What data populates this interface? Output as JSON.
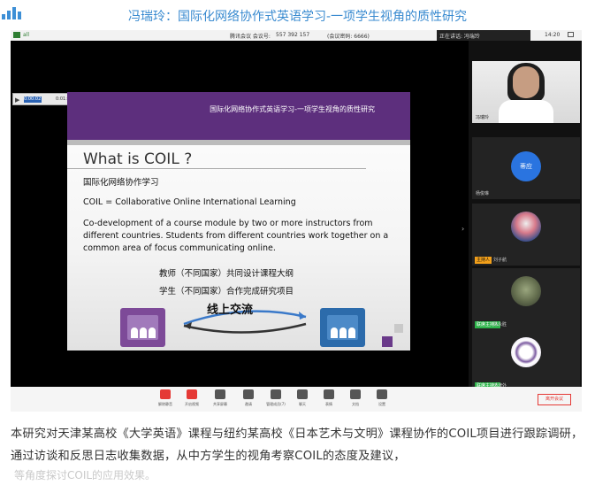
{
  "page": {
    "title": "冯瑞玲：国际化网络协作式英语学习-一项学生视角的质性研究"
  },
  "statusbar": {
    "signal": "all",
    "meeting_label": "腾讯会议 会议号:",
    "meeting_id": "557 392 157",
    "password_label": "(会议密码: 6666)",
    "speaking": "正在讲话: 冯瑞玲",
    "time": "14:20"
  },
  "player": {
    "position": "0:00:02",
    "duration": "0:01:09"
  },
  "slide": {
    "header_title": "国际化网络协作式英语学习-一项学生视角的质性研究",
    "heading": "What is COIL ?",
    "line1": "国际化网络协作学习",
    "line2": "COIL = Collaborative Online International Learning",
    "line3": "Co-development of a course module by two or more instructors from different countries. Students from different countries work together on a common area of focus communicating online.",
    "line4": "教师（不同国家）共同设计课程大纲",
    "line5": "学生（不同国家）合作完成研究项目",
    "arrow_label": "线上交流"
  },
  "gallery": {
    "self_name": "冯瑞玲",
    "tiles": [
      {
        "name": "杨俊琳",
        "avatar_text": "蒂应",
        "badge": ""
      },
      {
        "name": "刘子航",
        "badge": "主持人"
      },
      {
        "name": "陈永胜",
        "badge": "联席主持人"
      },
      {
        "name": "天津外",
        "badge": "联席主持人"
      }
    ]
  },
  "toolbar": {
    "items": [
      {
        "label": "解除静音",
        "icon": "mic-muted-icon"
      },
      {
        "label": "开启视频",
        "icon": "video-off-icon"
      },
      {
        "label": "共享屏幕",
        "icon": "screen-share-icon"
      },
      {
        "label": "邀请",
        "icon": "invite-icon"
      },
      {
        "label": "管理成员(7)",
        "icon": "members-icon"
      },
      {
        "label": "聊天",
        "icon": "chat-icon"
      },
      {
        "label": "表情",
        "icon": "emoji-icon"
      },
      {
        "label": "文档",
        "icon": "document-icon"
      },
      {
        "label": "设置",
        "icon": "settings-icon"
      }
    ],
    "end_label": "离开会议"
  },
  "caption": {
    "text": "本研究对天津某高校《大学英语》课程与纽约某高校《日本艺术与文明》课程协作的COIL项目进行跟踪调研，通过访谈和反思日志收集数据，从中方学生的视角考察COIL的态度及建议，",
    "tail": "等角度探讨COIL的应用效果。"
  },
  "colors": {
    "title_blue": "#3a8bd0",
    "slide_purple": "#5d2f7d",
    "end_red": "#e53935",
    "host_badge": "#f3a01a",
    "cohost_badge": "#2db34a"
  }
}
